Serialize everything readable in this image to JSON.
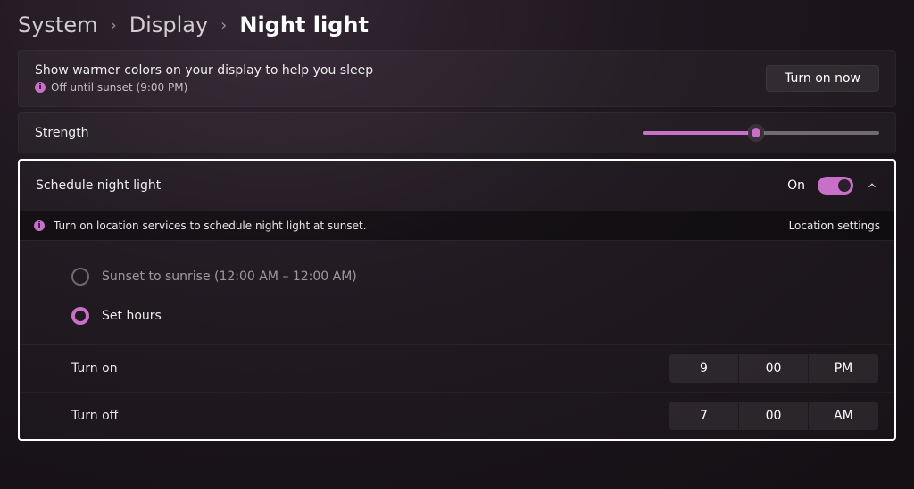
{
  "breadcrumb": {
    "level1": "System",
    "level2": "Display",
    "level3": "Night light"
  },
  "intro": {
    "title": "Show warmer colors on your display to help you sleep",
    "status": "Off until sunset (9:00 PM)",
    "button": "Turn on now"
  },
  "strength": {
    "label": "Strength",
    "value_percent": 48
  },
  "schedule": {
    "label": "Schedule night light",
    "state_text": "On",
    "state_on": true
  },
  "notice": {
    "text": "Turn on location services to schedule night light at sunset.",
    "link": "Location settings"
  },
  "radio": {
    "sunset_label": "Sunset to sunrise (12:00 AM – 12:00 AM)",
    "sethours_label": "Set hours",
    "selected": "sethours"
  },
  "times": {
    "on": {
      "label": "Turn on",
      "hour": "9",
      "minute": "00",
      "ampm": "PM"
    },
    "off": {
      "label": "Turn off",
      "hour": "7",
      "minute": "00",
      "ampm": "AM"
    }
  }
}
